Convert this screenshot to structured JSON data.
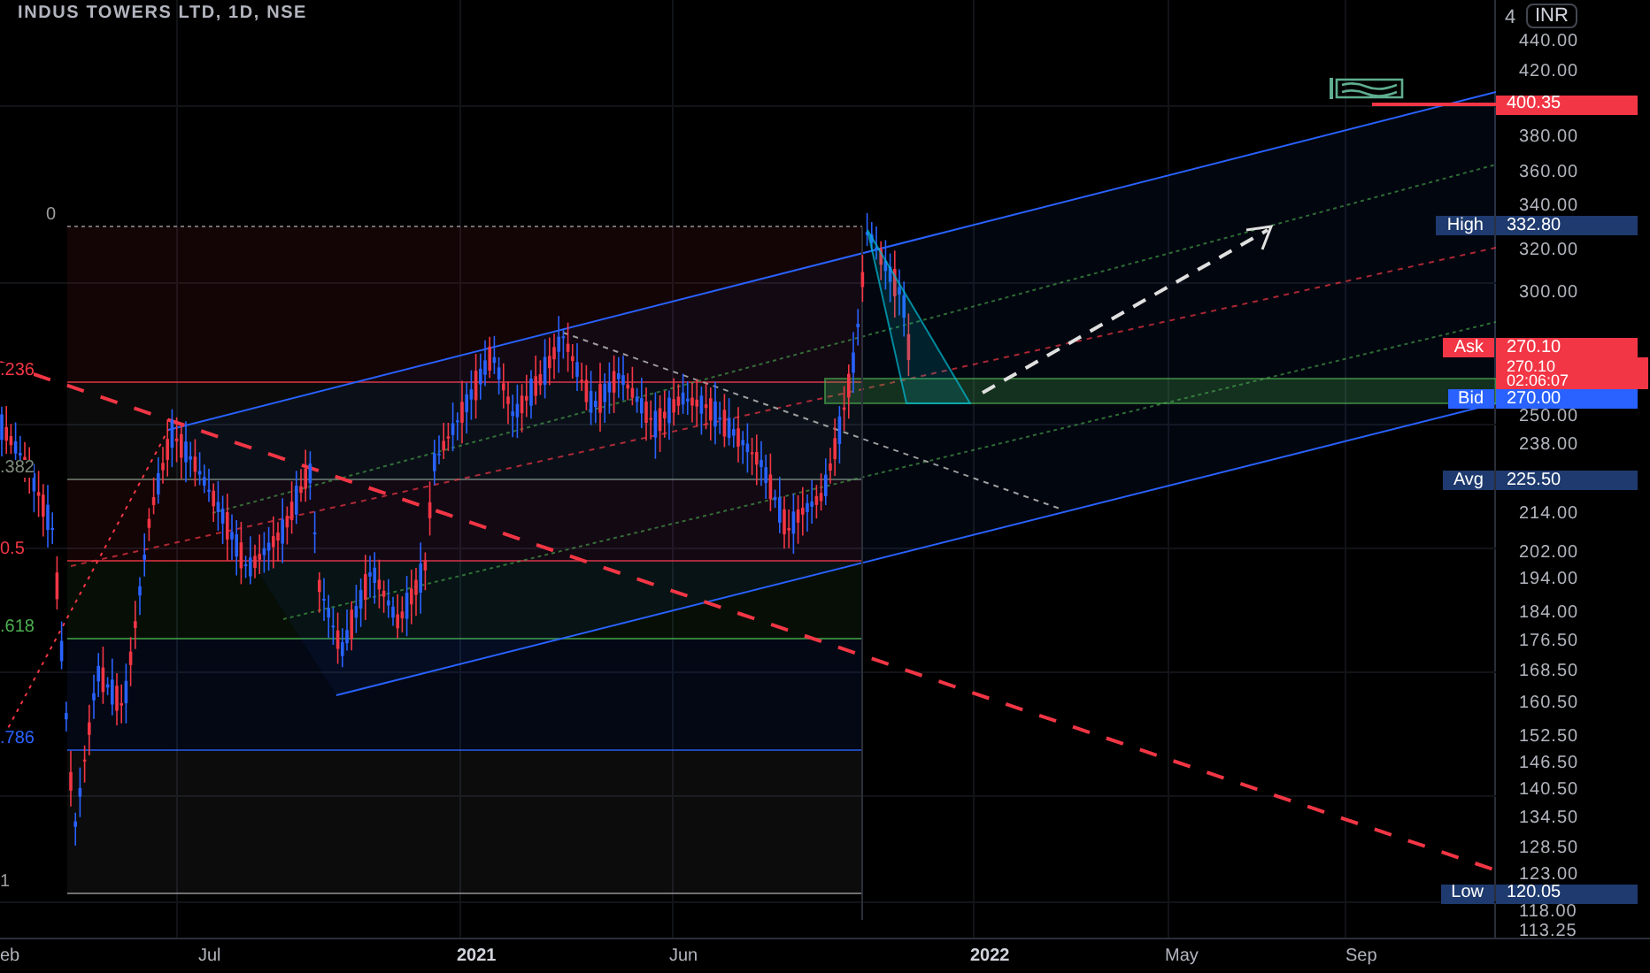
{
  "chart": {
    "title": "INDUS TOWERS LTD, 1D, NSE",
    "fib_levels": [
      {
        "label": "0",
        "color": "#9e9e9e"
      },
      {
        "label": ".236",
        "color": "#f23645"
      },
      {
        "label": ".382",
        "color": "#7e8a7a"
      },
      {
        "label": "0.5",
        "color": "#f23645"
      },
      {
        "label": ".618",
        "color": "#4caf50"
      },
      {
        "label": ".786",
        "color": "#2962ff"
      },
      {
        "label": "1",
        "color": "#9e9e9e"
      }
    ]
  },
  "price_axis": {
    "currency": "INR",
    "cut_label": "4",
    "ticks": [
      "440.00",
      "420.00",
      "380.00",
      "360.00",
      "340.00",
      "320.00",
      "300.00",
      "250.00",
      "238.00",
      "214.00",
      "202.00",
      "194.00",
      "184.00",
      "176.50",
      "168.50",
      "160.50",
      "152.50",
      "146.50",
      "140.50",
      "134.50",
      "128.50",
      "123.00",
      "118.00",
      "113.25"
    ],
    "badges": [
      {
        "kind": "alert",
        "value": "400.35",
        "color": "#f23645"
      },
      {
        "kind": "labeled",
        "label": "High",
        "value": "332.80",
        "color": "#1e3a6e"
      },
      {
        "kind": "labeled",
        "label": "Ask",
        "value": "270.10",
        "color": "#f23645"
      },
      {
        "kind": "countdown",
        "value": "270.10",
        "time": "02:06:07",
        "color": "#f23645"
      },
      {
        "kind": "labeled",
        "label": "Bid",
        "value": "270.00",
        "color": "#2962ff"
      },
      {
        "kind": "labeled",
        "label": "Avg",
        "value": "225.50",
        "color": "#1e3a6e"
      },
      {
        "kind": "labeled",
        "label": "Low",
        "value": "120.05",
        "color": "#1e3a6e"
      }
    ]
  },
  "time_axis": [
    {
      "label": "eb",
      "major": false
    },
    {
      "label": "Jul",
      "major": false
    },
    {
      "label": "2021",
      "major": true
    },
    {
      "label": "Jun",
      "major": false
    },
    {
      "label": "2022",
      "major": true
    },
    {
      "label": "May",
      "major": false
    },
    {
      "label": "Sep",
      "major": false
    }
  ]
}
